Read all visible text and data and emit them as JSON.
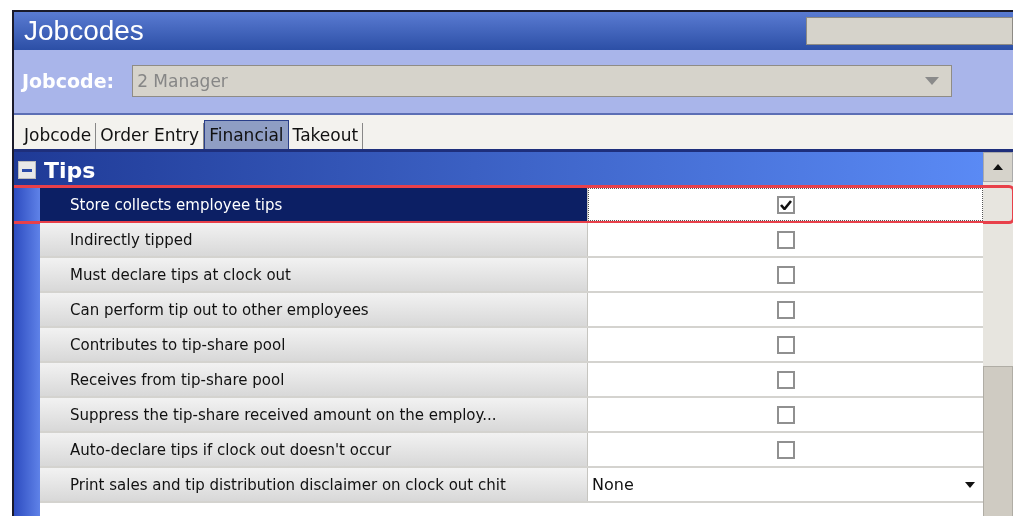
{
  "window": {
    "title": "Jobcodes"
  },
  "jobcode": {
    "label": "Jobcode:",
    "value": "2 Manager"
  },
  "tabs": [
    {
      "label": "Jobcode",
      "selected": false
    },
    {
      "label": "Order Entry",
      "selected": false
    },
    {
      "label": "Financial",
      "selected": true
    },
    {
      "label": "Takeout",
      "selected": false
    }
  ],
  "group": {
    "title": "Tips",
    "expanded": true
  },
  "rows": [
    {
      "kind": "checkbox",
      "label": "Store collects employee tips",
      "checked": true,
      "selected": true,
      "highlighted": true
    },
    {
      "kind": "checkbox",
      "label": "Indirectly tipped",
      "checked": false,
      "selected": false,
      "highlighted": false
    },
    {
      "kind": "checkbox",
      "label": "Must declare tips at clock out",
      "checked": false,
      "selected": false,
      "highlighted": false
    },
    {
      "kind": "checkbox",
      "label": "Can perform tip out to other employees",
      "checked": false,
      "selected": false,
      "highlighted": false
    },
    {
      "kind": "checkbox",
      "label": "Contributes to tip-share pool",
      "checked": false,
      "selected": false,
      "highlighted": false
    },
    {
      "kind": "checkbox",
      "label": "Receives from tip-share pool",
      "checked": false,
      "selected": false,
      "highlighted": false
    },
    {
      "kind": "checkbox",
      "label": "Suppress the tip-share received amount on the employ...",
      "checked": false,
      "selected": false,
      "highlighted": false
    },
    {
      "kind": "checkbox",
      "label": "Auto-declare tips if clock out doesn't occur",
      "checked": false,
      "selected": false,
      "highlighted": false
    },
    {
      "kind": "dropdown",
      "label": "Print sales and tip distribution disclaimer on clock out chit",
      "value": "None",
      "selected": false,
      "highlighted": false
    }
  ]
}
